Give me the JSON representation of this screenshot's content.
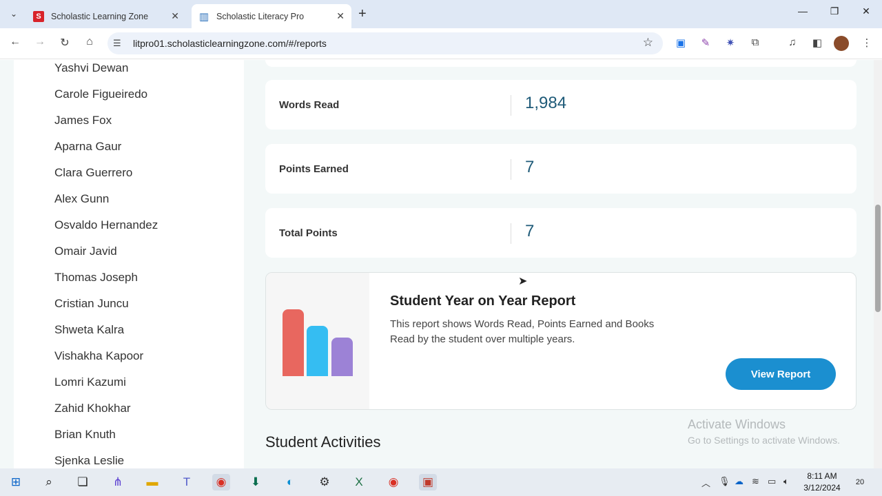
{
  "browser": {
    "tabs": [
      {
        "title": "Scholastic Learning Zone",
        "favicon": "S"
      },
      {
        "title": "Scholastic Literacy Pro",
        "favicon": "books-icon"
      }
    ],
    "url": "litpro01.scholasticlearningzone.com/#/reports"
  },
  "sidebar": {
    "students": [
      "Yashvi Dewan",
      "Carole Figueiredo",
      "James Fox",
      "Aparna Gaur",
      "Clara Guerrero",
      "Alex Gunn",
      "Osvaldo Hernandez",
      "Omair Javid",
      "Thomas Joseph",
      "Cristian Juncu",
      "Shweta Kalra",
      "Vishakha Kapoor",
      "Lomri Kazumi",
      "Zahid Khokhar",
      "Brian Knuth",
      "Sjenka Leslie"
    ]
  },
  "stats": [
    {
      "label": "Words Read",
      "value": "1,984"
    },
    {
      "label": "Points Earned",
      "value": "7"
    },
    {
      "label": "Total Points",
      "value": "7"
    }
  ],
  "report": {
    "title": "Student Year on Year Report",
    "description": "This report shows Words Read, Points Earned and Books Read by the student over multiple years.",
    "button": "View Report",
    "bar_colors": [
      "#e8675f",
      "#35bdf2",
      "#9c82d6"
    ]
  },
  "section_title": "Student Activities",
  "watermark": {
    "line1": "Activate Windows",
    "line2": "Go to Settings to activate Windows."
  },
  "taskbar": {
    "time": "8:11 AM",
    "date": "3/12/2024",
    "notifications": "20"
  }
}
